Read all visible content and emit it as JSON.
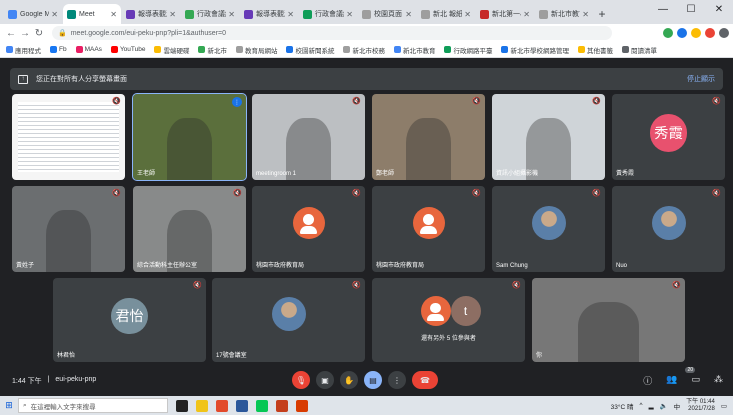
{
  "browser": {
    "tabs": [
      {
        "label": "Google Me",
        "color": "#4285f4",
        "active": false
      },
      {
        "label": "Meet",
        "color": "#00897b",
        "active": true
      },
      {
        "label": "報導表觀測",
        "color": "#673ab7",
        "active": false
      },
      {
        "label": "行政會議紀",
        "color": "#34a853",
        "active": false
      },
      {
        "label": "報導表觀測",
        "color": "#673ab7",
        "active": false
      },
      {
        "label": "行政會議紀",
        "color": "#0f9d58",
        "active": false
      },
      {
        "label": "校園頁面",
        "color": "#9e9e9e",
        "active": false
      },
      {
        "label": "新北 報紙",
        "color": "#9e9e9e",
        "active": false
      },
      {
        "label": "新北第一小",
        "color": "#c62828",
        "active": false
      },
      {
        "label": "新北市教育",
        "color": "#9e9e9e",
        "active": false
      }
    ],
    "new_tab": "+",
    "window_controls": [
      "—",
      "☐",
      "✕"
    ],
    "url": "meet.google.com/eui-peku-pnp?pli=1&authuser=0",
    "bookmarks": [
      "應用程式",
      "Fb",
      "MAAs",
      "YouTube",
      "雲端硬碟",
      "新北市",
      "教育局網站",
      "校園新聞系統",
      "新北市校務",
      "新北市教育",
      "行政網路平臺",
      "新北市學校網路管理",
      "其他書籤",
      "閱讀清單"
    ]
  },
  "meet": {
    "banner_text": "您正在對所有人分享螢幕畫面",
    "banner_action": "停止顯示",
    "participants": [
      {
        "name": "",
        "kind": "screen"
      },
      {
        "name": "王老師",
        "kind": "video-speaking"
      },
      {
        "name": "meetingroom 1",
        "kind": "video"
      },
      {
        "name": "鄭老師",
        "kind": "video"
      },
      {
        "name": "資訊小組攝影機",
        "kind": "video"
      },
      {
        "name": "黃秀霞",
        "kind": "avatar",
        "initials": "秀霞",
        "color": "#e8516e"
      },
      {
        "name": "黃姓子",
        "kind": "video"
      },
      {
        "name": "綜合活動科主任辦公室",
        "kind": "video"
      },
      {
        "name": "桃園市政府教育局",
        "kind": "person",
        "color": "#e8663d"
      },
      {
        "name": "桃園市政府教育局",
        "kind": "person",
        "color": "#e8663d"
      },
      {
        "name": "Sam Chung",
        "kind": "photo"
      },
      {
        "name": "Nuo",
        "kind": "photo"
      },
      {
        "name": "林君怡",
        "kind": "avatar",
        "initials": "君怡",
        "color": "#78909c"
      },
      {
        "name": "17號會議室",
        "kind": "photo"
      },
      {
        "name": "還有另外 5 位參與者",
        "kind": "more"
      },
      {
        "name": "你",
        "kind": "video"
      }
    ],
    "time": "1:44 下午",
    "meeting_code": "eui-peku-pnp",
    "people_count": "20"
  },
  "taskbar": {
    "search_placeholder": "在這裡輸入文字來搜尋",
    "weather": "33°C 晴",
    "lang": "中",
    "time": "下午 01:44",
    "date": "2021/7/28"
  }
}
